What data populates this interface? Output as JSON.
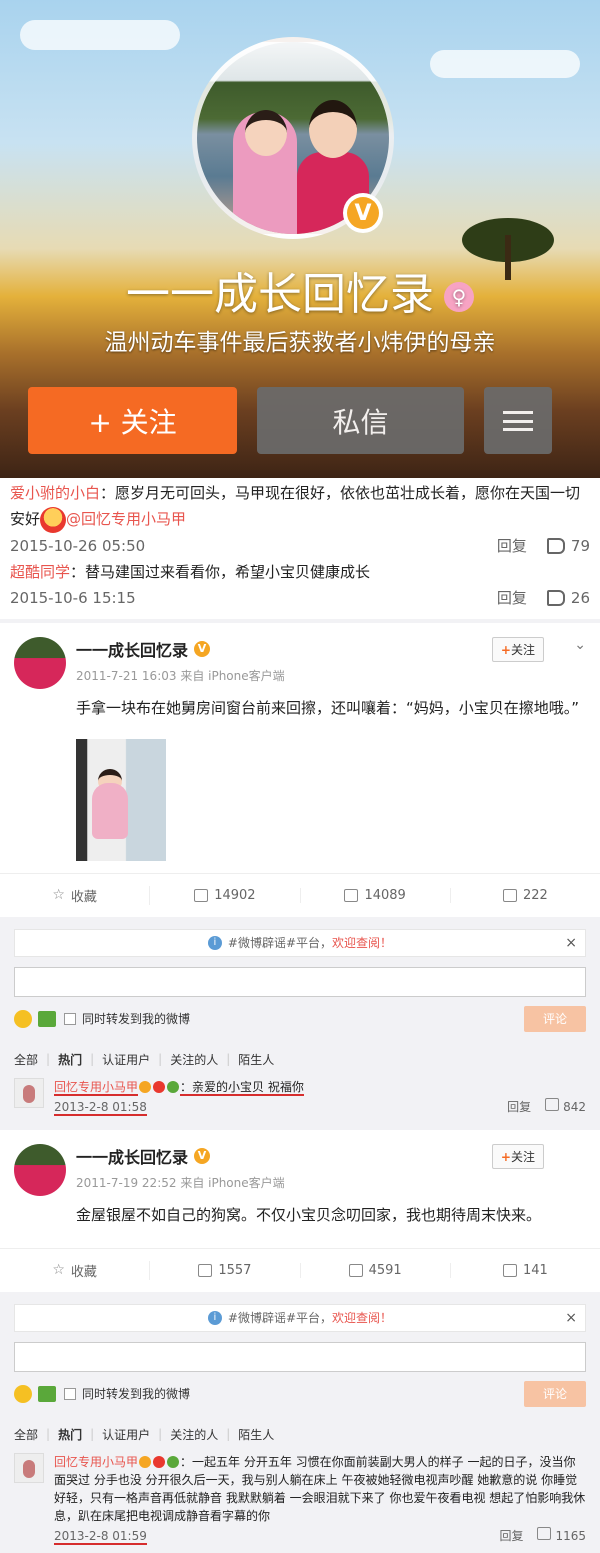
{
  "profile": {
    "name": "一一成长回忆录",
    "bio": "温州动车事件最后获救者小炜伊的母亲",
    "verified_badge": "V",
    "gender_symbol": "♀",
    "follow_label": "+ 关注",
    "message_label": "私信"
  },
  "comments": [
    {
      "user": "爱小驸的小白",
      "text": "：愿岁月无可回头，马甲现在很好，依依也茁壮成长着，愿你在天国一切安好",
      "mention": "@回忆专用小马甲",
      "time": "2015-10-26 05:50",
      "reply": "回复",
      "likes": "79"
    },
    {
      "user": "超酷同学",
      "text": "：替马建国过来看看你，希望小宝贝健康成长",
      "time": "2015-10-6 15:15",
      "reply": "回复",
      "likes": "26"
    }
  ],
  "posts": [
    {
      "author": "一一成长回忆录",
      "time": "2011-7-21 16:03 来自 iPhone客户端",
      "text": "手拿一块布在她舅房间窗台前来回擦，还叫嚷着：“妈妈，小宝贝在擦地哦。”",
      "follow": "关注",
      "actions": {
        "fav": "收藏",
        "repost": "14902",
        "comment": "14089",
        "like": "222"
      },
      "notice": "#微博辟谣#平台，",
      "notice_red": "欢迎查阅！",
      "sync_label": "同时转发到我的微博",
      "send_label": "评论",
      "tabs": [
        "全部",
        "热门",
        "认证用户",
        "关注的人",
        "陌生人"
      ],
      "hot": {
        "user": "回忆专用小马甲",
        "text": "：亲爱的小宝贝 祝福你",
        "time": "2013-2-8 01:58",
        "reply": "回复",
        "likes": "842"
      }
    },
    {
      "author": "一一成长回忆录",
      "time": "2011-7-19 22:52 来自 iPhone客户端",
      "text": "金屋银屋不如自己的狗窝。不仅小宝贝念叨回家，我也期待周末快来。",
      "follow": "关注",
      "actions": {
        "fav": "收藏",
        "repost": "1557",
        "comment": "4591",
        "like": "141"
      },
      "notice": "#微博辟谣#平台，",
      "notice_red": "欢迎查阅！",
      "sync_label": "同时转发到我的微博",
      "send_label": "评论",
      "tabs": [
        "全部",
        "热门",
        "认证用户",
        "关注的人",
        "陌生人"
      ],
      "hot": {
        "user": "回忆专用小马甲",
        "text": "：一起五年 分开五年 习惯在你面前装副大男人的样子 一起的日子，没当你面哭过 分手也没 分开很久后一天，我与别人躺在床上 午夜被她轻微电视声吵醒 她歉意的说 你睡觉好轻，只有一格声音再低就静音 我默默躺着 一会眼泪就下来了 你也爱午夜看电视 想起了怕影响我休息，趴在床尾把电视调成静音看字幕的你",
        "time": "2013-2-8 01:59",
        "reply": "回复",
        "likes": "1165"
      }
    }
  ],
  "icons": {
    "close": "×",
    "chevron": "⌄",
    "info": "i",
    "star": "☆"
  }
}
